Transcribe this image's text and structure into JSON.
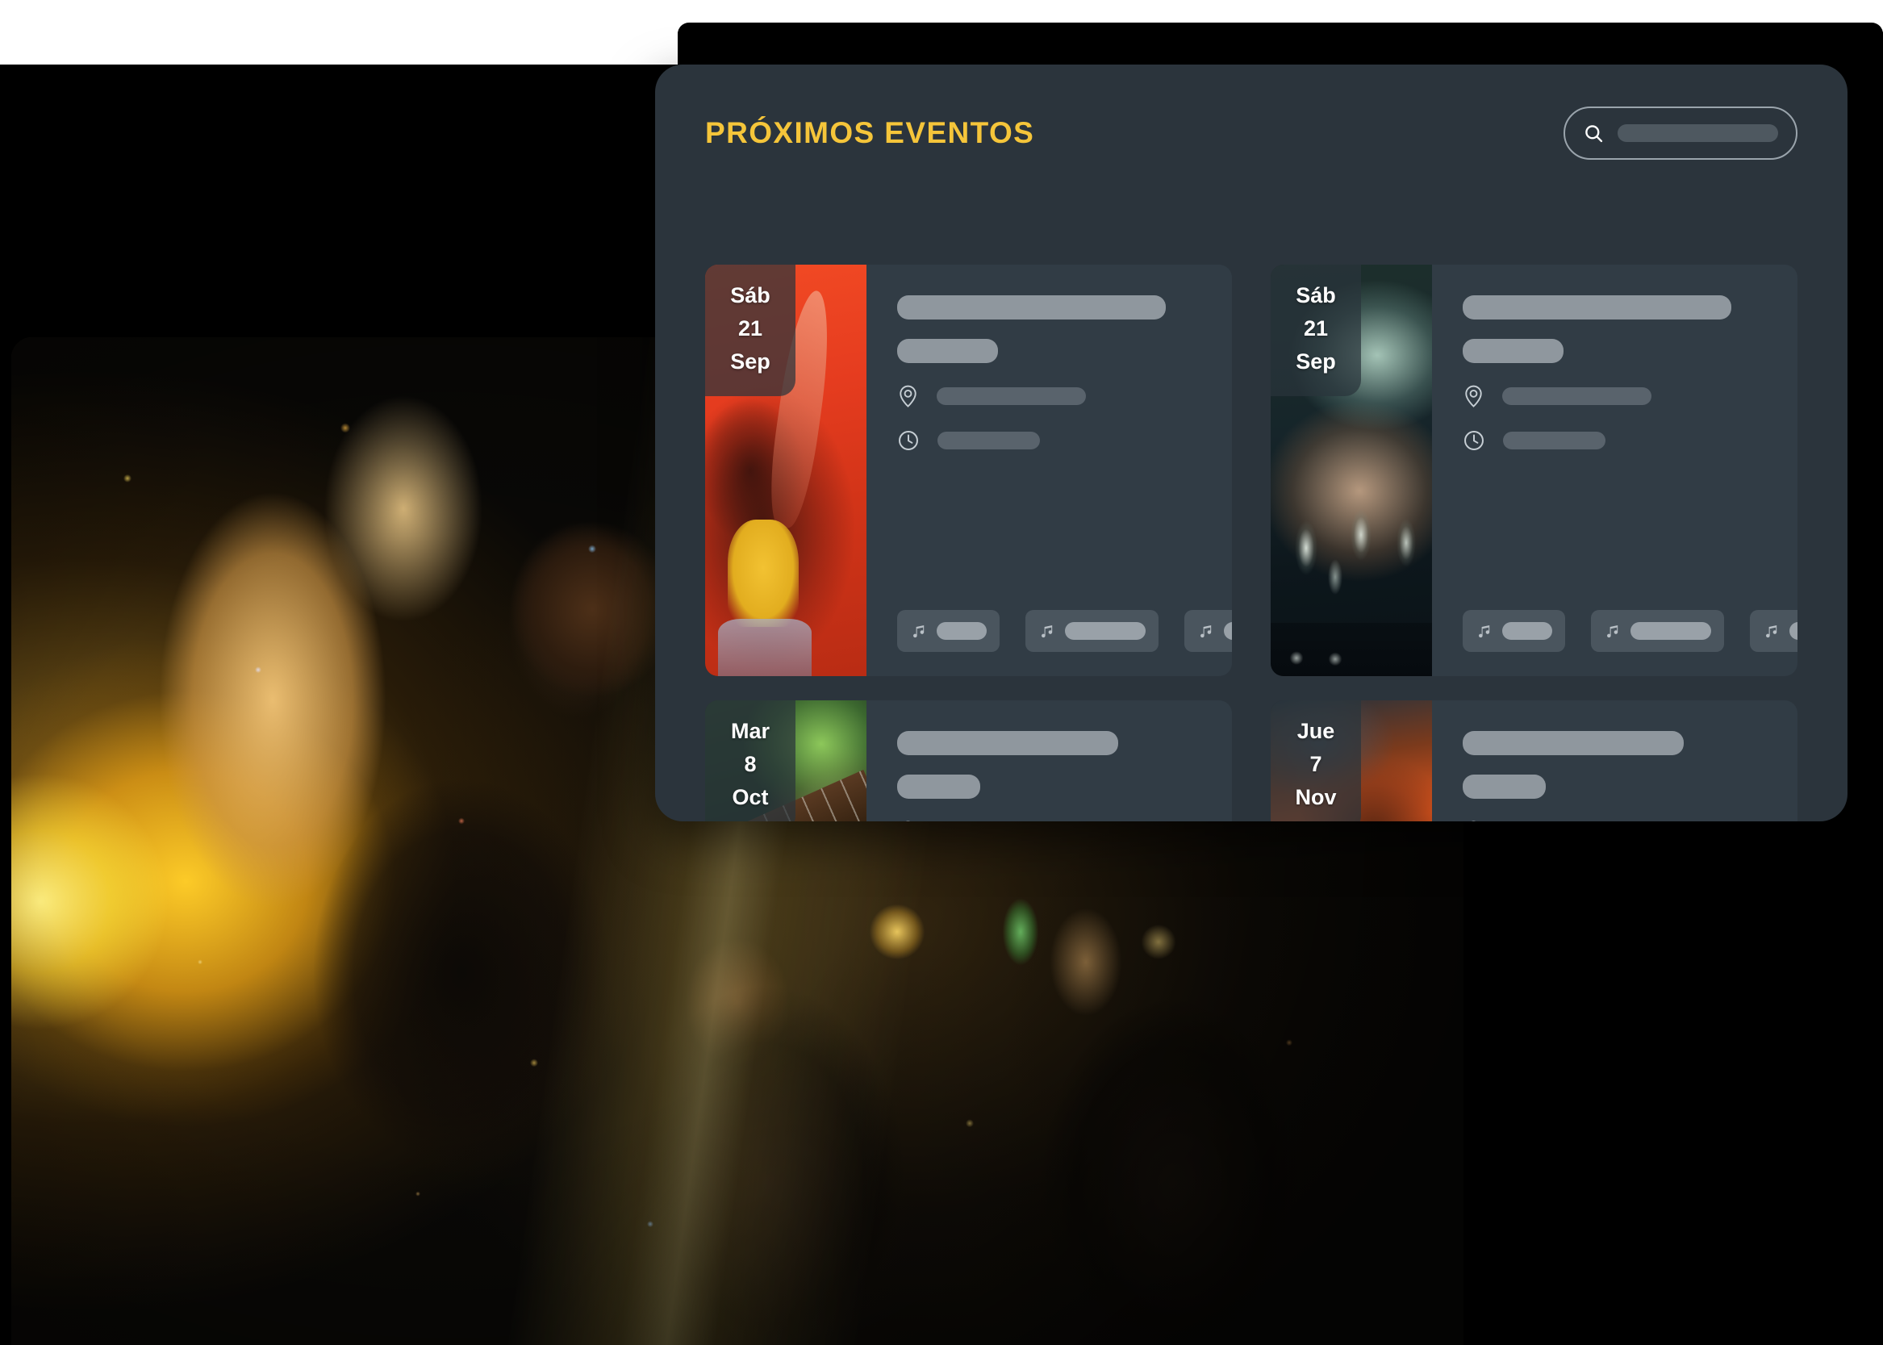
{
  "panel": {
    "title": "PRÓXIMOS EVENTOS",
    "title_color": "#f5c53a",
    "background_color": "#2b343c",
    "card_background_color": "#313c45"
  },
  "search": {
    "icon": "search-icon",
    "value": "",
    "placeholder": ""
  },
  "events": [
    {
      "weekday": "Sáb",
      "day": "21",
      "month": "Sep",
      "thumb": "crowd-woman-red-light-photo",
      "location_icon": "map-pin-icon",
      "time_icon": "clock-icon",
      "tags": [
        {
          "icon": "music-note-icon"
        },
        {
          "icon": "music-note-icon"
        },
        {
          "icon": "music-note-icon"
        }
      ]
    },
    {
      "weekday": "Sáb",
      "day": "21",
      "month": "Sep",
      "thumb": "dj-mixer-hands-photo",
      "location_icon": "map-pin-icon",
      "time_icon": "clock-icon",
      "tags": [
        {
          "icon": "music-note-icon"
        },
        {
          "icon": "music-note-icon"
        },
        {
          "icon": "music-note-icon"
        }
      ]
    },
    {
      "weekday": "Mar",
      "day": "8",
      "month": "Oct",
      "thumb": "guitarist-green-light-photo",
      "location_icon": "map-pin-icon",
      "time_icon": "clock-icon",
      "tags": []
    },
    {
      "weekday": "Jue",
      "day": "7",
      "month": "Nov",
      "thumb": "singer-microphone-orange-light-photo",
      "location_icon": "map-pin-icon",
      "time_icon": "clock-icon",
      "tags": []
    }
  ],
  "hero": {
    "photo": "nightclub-dancing-crowd-golden-flare-photo"
  }
}
